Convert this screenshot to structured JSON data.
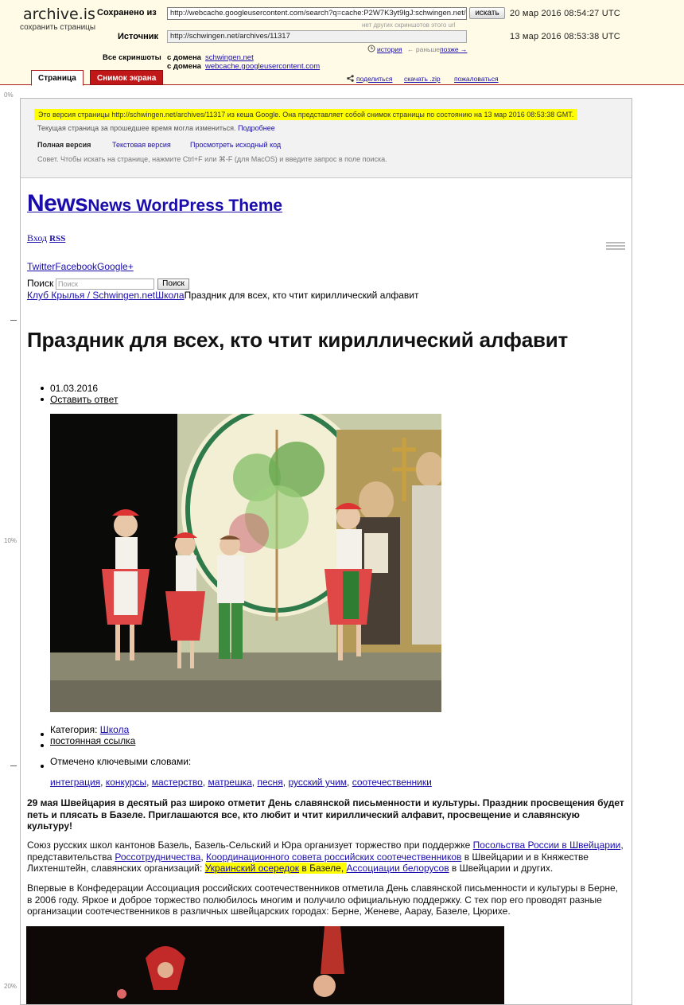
{
  "archive": {
    "logo": "archive.is",
    "logo_sub": "сохранить страницы",
    "saved_from_label": "Сохранено из",
    "saved_from_url": "http://webcache.googleusercontent.com/search?q=cache:P2W7K3yt9lgJ:schwingen.net/ar",
    "go_button": "искать",
    "no_other_snapshots": "нет других скриншотов этого url",
    "saved_date": "20 мар 2016 08:54:27 UTC",
    "source_label": "Источник",
    "source_url": "http://schwingen.net/archives/11317",
    "source_date": "13 мар 2016 08:53:38 UTC",
    "history": "история",
    "earlier": "← раньше",
    "later": "позже →",
    "all_screenshots_label": "Все скриншоты",
    "from_domain_label": "с домена",
    "domain_1": "schwingen.net",
    "domain_2": "webcache.googleusercontent.com",
    "tab_page": "Страница",
    "tab_screenshot": "Снимок экрана",
    "share": "поделиться",
    "download_zip": "скачать .zip",
    "report": "пожаловаться"
  },
  "ruler": {
    "p0": "0%",
    "p10": "10%",
    "p20": "20%"
  },
  "cache": {
    "notice": "Это версия страницы http://schwingen.net/archives/11317 из кеша Google. Она представляет собой снимок страницы по состоянию на 13 мар 2016 08:53:38 GMT.",
    "notice2": "Текущая страница за прошедшее время могла измениться.",
    "more": "Подробнее",
    "full_version": "Полная версия",
    "text_version": "Текстовая версия",
    "view_source": "Просмотреть исходный код",
    "tip": "Совет. Чтобы искать на странице, нажмите Ctrl+F или ⌘-F (для MacOS) и введите запрос в поле поиска."
  },
  "site": {
    "title_big": "News",
    "title_small": "News WordPress Theme",
    "login": "Вход",
    "rss": "RSS",
    "social": "TwitterFacebookGoogle+",
    "search_label": "Поиск",
    "search_placeholder": "Поиск",
    "search_button": "Поиск",
    "crumb_1": "Клуб Крылья / Schwingen.net",
    "crumb_2": "Школа",
    "crumb_3": "Праздник для всех, кто чтит кириллический алфавит"
  },
  "article": {
    "title": "Праздник для всех, кто чтит кириллический алфавит",
    "date": "01.03.2016",
    "reply": "Оставить ответ",
    "category_label": "Категория:",
    "category": "Школа",
    "permalink": "постоянная ссылка",
    "tags_label": "Отмечено ключевыми словами:",
    "tags": [
      "интеграция",
      "конкурсы",
      "мастерство",
      "матрешка",
      "песня",
      "русский учим",
      "соотечественники"
    ],
    "lead": "29 мая Швейцария в десятый раз широко отметит День славянской письменности и культуры. Праздник просвещения будет петь и плясать в Базеле. Приглашаются все, кто любит и чтит кириллический алфавит, просвещение и славянскую культуру!",
    "p2_a": "Союз русских школ кантонов Базель, Базель-Сельский и Юра организует торжество при поддержке ",
    "p2_link1": "Посольства России в Швейцарии",
    "p2_b": ", представительства ",
    "p2_link2": "Россотрудничества",
    "p2_c": ", ",
    "p2_link3": "Координационного совета российских соотечественников",
    "p2_d": " в Швейцарии и в Княжестве Лихтенштейн, славянских организаций: ",
    "p2_link4": "Украинский осередок",
    "p2_e": " в Базеле, ",
    "p2_link5": "Ассоциации белорусов",
    "p2_f": " в Швейцарии и других.",
    "p3": "Впервые в Конфедерации Ассоциация российских соотечественников отметила День славянской письменности и культуры в Берне, в 2006 году. Яркое и доброе торжество полюбилось многим и получило официальную поддержку. С тех пор его проводят разные организации соотечественников в различных швейцарских городах: Берне, Женеве, Аарау, Базеле, Цюрихе."
  },
  "colors": {
    "link": "#1a0dab",
    "highlight": "#ffff00",
    "tab_red": "#c01818",
    "header_bg": "#fffbe6"
  }
}
